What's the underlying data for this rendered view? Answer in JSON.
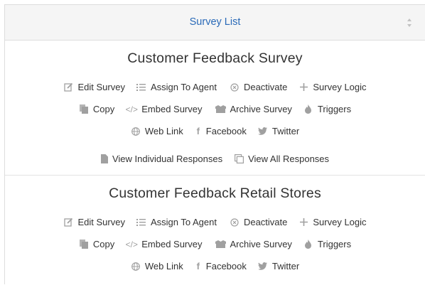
{
  "header": {
    "title": "Survey List"
  },
  "icons": {
    "edit": "edit-icon",
    "assign": "list-icon",
    "deactivate": "circle-x-icon",
    "logic": "plus-icon",
    "copy": "copy-icon",
    "embed": "code-icon",
    "archive": "archive-icon",
    "triggers": "flame-icon",
    "weblink": "globe-icon",
    "facebook": "facebook-icon",
    "twitter": "twitter-icon",
    "individual": "file-icon",
    "all": "squares-icon"
  },
  "colors": {
    "link": "#2a6ab8",
    "icon": "#a0a0a0",
    "text": "#333333"
  },
  "surveys": [
    {
      "title": "Customer Feedback Survey",
      "actions": {
        "edit": "Edit Survey",
        "assign": "Assign To Agent",
        "deactivate": "Deactivate",
        "logic": "Survey Logic",
        "copy": "Copy",
        "embed": "Embed Survey",
        "archive": "Archive Survey",
        "triggers": "Triggers",
        "weblink": "Web Link",
        "facebook": "Facebook",
        "twitter": "Twitter",
        "individual": "View Individual Responses",
        "all": "View All Responses"
      }
    },
    {
      "title": "Customer Feedback Retail Stores",
      "actions": {
        "edit": "Edit Survey",
        "assign": "Assign To Agent",
        "deactivate": "Deactivate",
        "logic": "Survey Logic",
        "copy": "Copy",
        "embed": "Embed Survey",
        "archive": "Archive Survey",
        "triggers": "Triggers",
        "weblink": "Web Link",
        "facebook": "Facebook",
        "twitter": "Twitter"
      }
    }
  ]
}
